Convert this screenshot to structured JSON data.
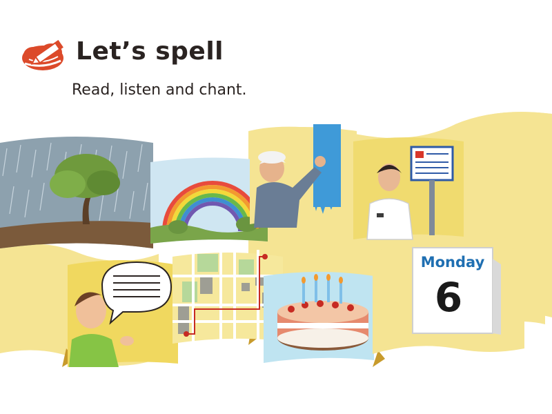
{
  "header": {
    "title": "Let’s spell",
    "subtitle": "Read, listen and chant."
  },
  "calendar": {
    "month_label": "Monday",
    "day_number": "6"
  },
  "icons": {
    "logo": "pencil-in-red-cloud-icon"
  },
  "colors": {
    "ribbon": "#f5e493",
    "ribbon_shadow": "#c89b2c",
    "logo_red": "#dc4a2a",
    "calendar_blue": "#1f6fb2"
  }
}
